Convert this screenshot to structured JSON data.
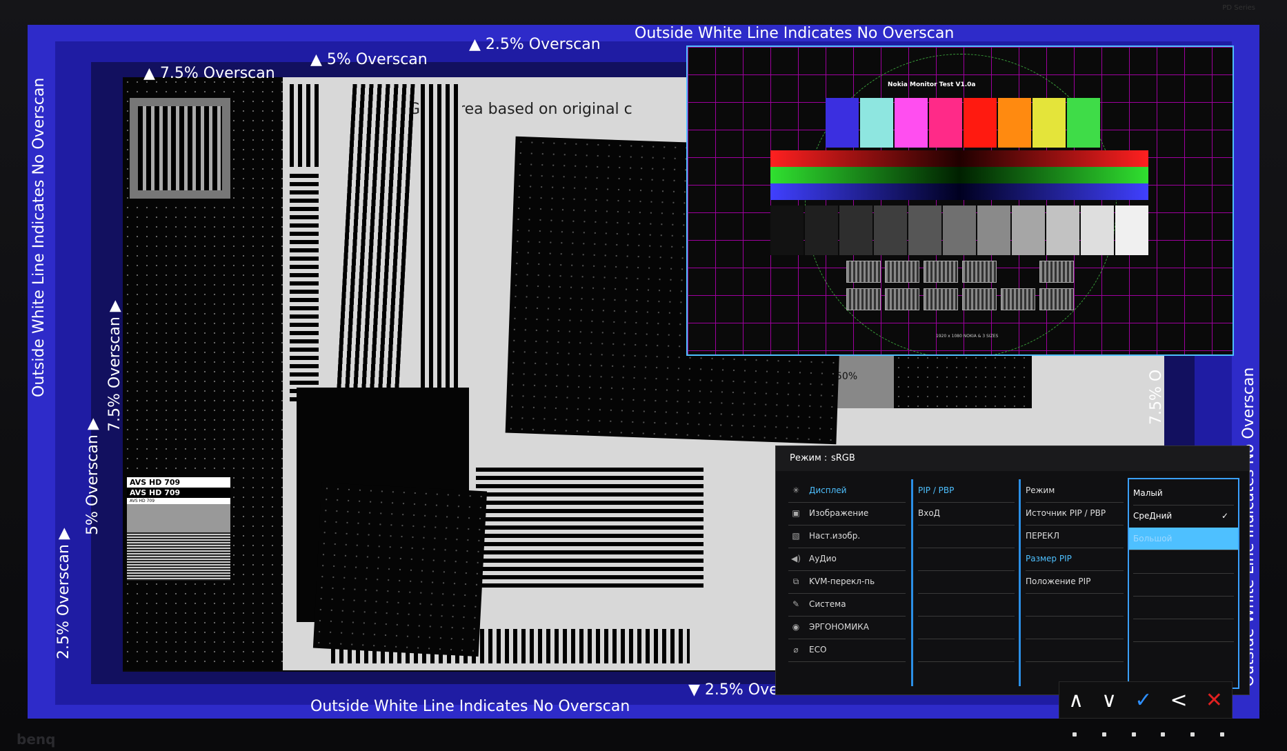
{
  "monitor": {
    "brand": "benq",
    "model": "PD Series"
  },
  "test_pattern": {
    "labels": {
      "no_overscan": "Outside White Line Indicates No Overscan",
      "overscan_2_5": "2.5% Overscan",
      "overscan_5": "5% Overscan",
      "overscan_7_5": "7.5% Overscan",
      "overscan_7_5_short": "7.5% O",
      "gray_area": "Gray area based on original c",
      "percent_50": "50%",
      "avs": "AVS HD 709",
      "avs_small": "AVS HD 709"
    }
  },
  "pip": {
    "title": "Nokia Monitor Test V1.0a",
    "caption": "1920 x 1080 NOKIA & 3 SIZES",
    "color_bars": [
      "#3b2fe0",
      "#8ee6e0",
      "#ff4ef0",
      "#ff2a88",
      "#ff1a10",
      "#ff8a10",
      "#e4e43a",
      "#3fdc48"
    ],
    "gray_steps": [
      "#121212",
      "#1f1f1f",
      "#2e2e2e",
      "#3e3e3e",
      "#565656",
      "#707070",
      "#8a8a8a",
      "#a6a6a6",
      "#c2c2c2",
      "#dedede",
      "#f0f0f0"
    ]
  },
  "osd": {
    "header_label": "Режим :",
    "header_value": "sRGB",
    "menu": [
      {
        "label": "Дисплей",
        "icon": "✳"
      },
      {
        "label": "Изображение",
        "icon": "▣"
      },
      {
        "label": "Наст.изобр.",
        "icon": "▧"
      },
      {
        "label": "АуДио",
        "icon": "◀)"
      },
      {
        "label": "KVM-перекл-пь",
        "icon": "⧉"
      },
      {
        "label": "Система",
        "icon": "✎"
      },
      {
        "label": "ЭРГОНОМИКА",
        "icon": "◉"
      },
      {
        "label": "ECO",
        "icon": "⌀"
      }
    ],
    "submenu": [
      "PIP / PBP",
      "ВхоД"
    ],
    "options": [
      "Режим",
      "Источник PIP / PBP",
      "ПЕРЕКЛ",
      "Размер PIP",
      "Положение PIP"
    ],
    "values": [
      "Малый",
      "СреДний",
      "Большой"
    ],
    "checked_value_mark": "✓"
  },
  "nav": {
    "up": "∧",
    "down": "∨",
    "ok": "✓",
    "back": "<",
    "close": "✕"
  }
}
